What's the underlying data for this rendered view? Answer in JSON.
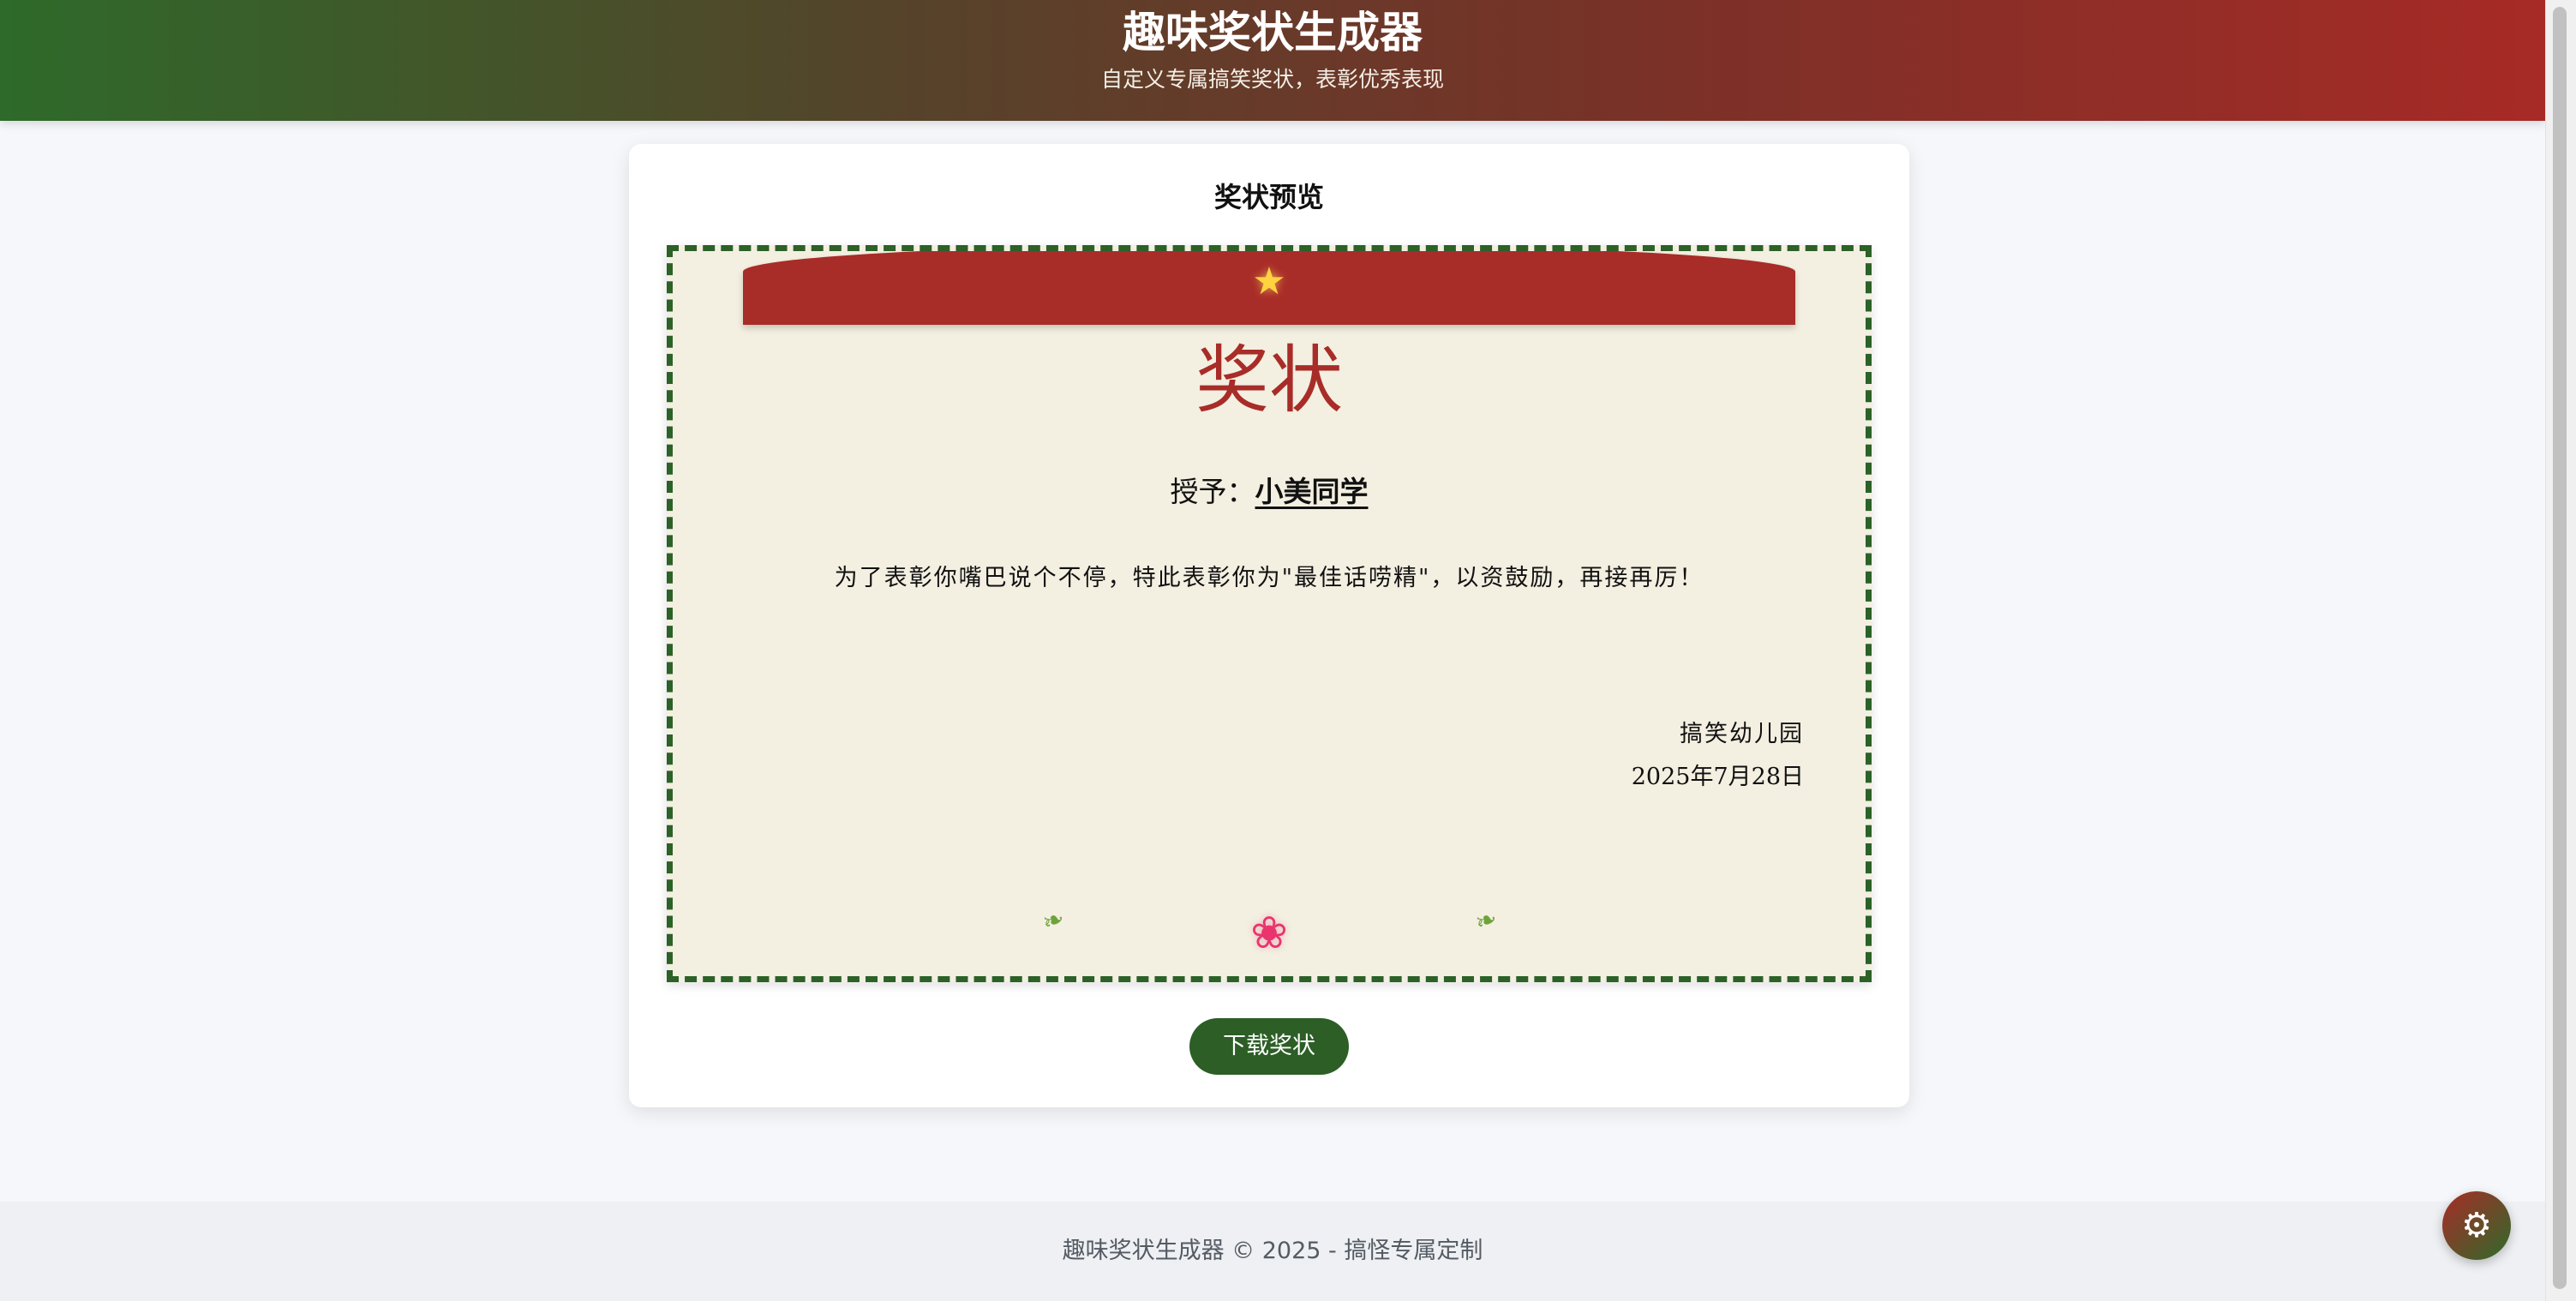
{
  "header": {
    "title": "趣味奖状生成器",
    "subtitle": "自定义专属搞笑奖状，表彰优秀表现"
  },
  "preview": {
    "title": "奖状预览",
    "certificate": {
      "star_icon": "star-icon",
      "heading": "奖状",
      "recipient_prefix": "授予：",
      "recipient_name": "小美同学",
      "body": "为了表彰你嘴巴说个不停，特此表彰你为\"最佳话唠精\"，以资鼓励，再接再厉！",
      "issuer": "搞笑幼儿园",
      "date": "2025年7月28日",
      "decor_icons": [
        "leaf-icon",
        "flower-icon",
        "leaf-icon"
      ]
    },
    "download_label": "下载奖状"
  },
  "footer": {
    "text": "趣味奖状生成器 © 2025 - 搞怪专属定制"
  },
  "settings": {
    "icon": "gear-icon"
  },
  "colors": {
    "header_gradient_start": "#2e6a2a",
    "header_gradient_end": "#a72a26",
    "certificate_red": "#a82c28",
    "border_green": "#2c6128",
    "certificate_bg": "#f3efe1",
    "button_green": "#2c5e26"
  }
}
